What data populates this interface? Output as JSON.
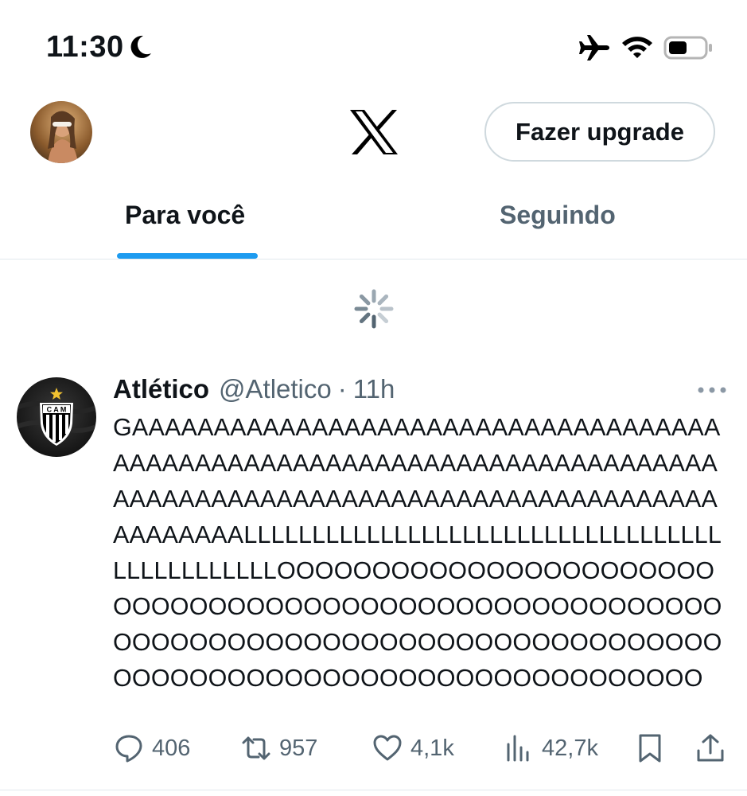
{
  "status_bar": {
    "time": "11:30",
    "icons": [
      "moon-icon",
      "airplane-icon",
      "wifi-icon",
      "battery-icon"
    ]
  },
  "header": {
    "logo": "x-logo-icon",
    "upgrade_label": "Fazer upgrade"
  },
  "tabs": [
    {
      "label": "Para você",
      "active": true
    },
    {
      "label": "Seguindo",
      "active": false
    }
  ],
  "tweet": {
    "author": "Atlético",
    "handle": "@Atletico",
    "separator": "·",
    "age": "11h",
    "text": "GAAAAAAAAAAAAAAAAAAAAAAAAAAAAAAAAAAAAAAAAAAAAAAAAAAAAAAAAAAAAAAAAAAAAAAAAAAAAAAAAAAAAAAAAAAAAAAAAAAAAAAAAAAAAAAAAAAAAAALLLLLLLLLLLLLLLLLLLLLLLLLLLLLLLLLLLLLLLLLLLLLLLOOOOOOOOOOOOOOOOOOOOOOOOOOOOOOOOOOOOOOOOOOOOOOOOOOOOOOOOOOOOOOOOOOOOOOOOOOOOOOOOOOOOOOOOOOOOOOOOOOOOOOOOOOOOOOOOOOOOOO",
    "actions": {
      "replies": "406",
      "retweets": "957",
      "likes": "4,1k",
      "views": "42,7k"
    }
  },
  "colors": {
    "accent": "#1d9bf0",
    "text": "#0f1419",
    "muted": "#536471",
    "border": "#cfd9de"
  }
}
